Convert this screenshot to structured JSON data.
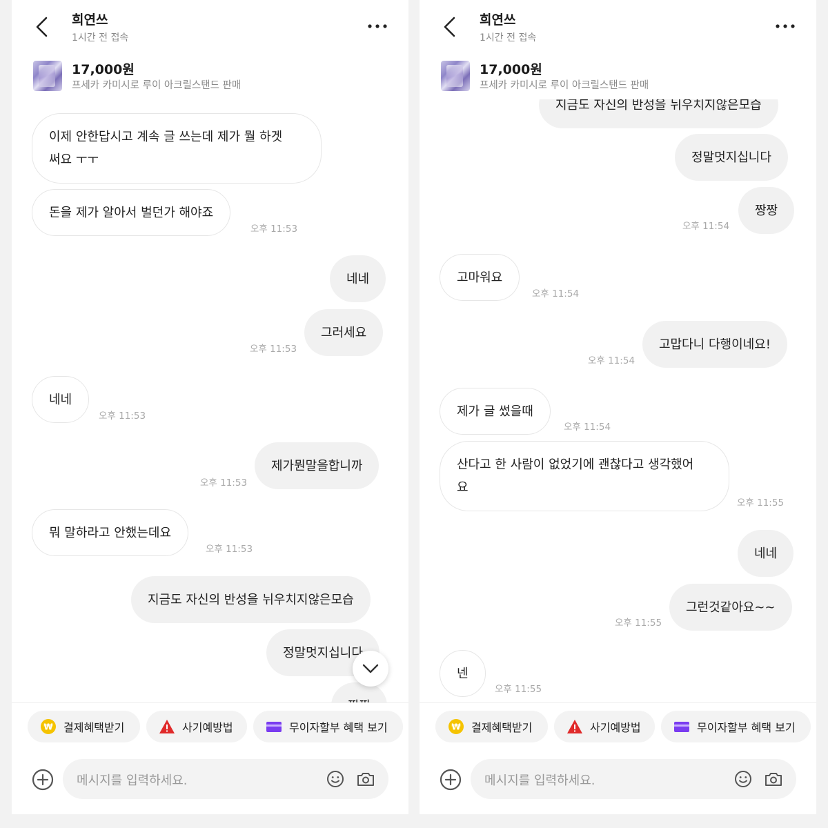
{
  "screens": [
    {
      "header": {
        "title": "희연쓰",
        "subtitle": "1시간 전 접속"
      },
      "product": {
        "price": "17,000원",
        "name": "프세카 카미시로 루이 아크릴스탠드 판매"
      },
      "messages": [
        {
          "text": "이제 안한답시고 계속 글 쓰는데 제가 뭘 하겟써요 ㅜㅜ"
        },
        {
          "text": "돈을 제가 알아서 벌던가 해야죠",
          "time": "오후 11:53"
        },
        {
          "text": "네네"
        },
        {
          "text": "그러세요",
          "time": "오후 11:53"
        },
        {
          "text": "네네",
          "time": "오후 11:53"
        },
        {
          "text": "제가뭔말을합니까",
          "time": "오후 11:53"
        },
        {
          "text": "뭐 말하라고 안했는데요",
          "time": "오후 11:53"
        },
        {
          "text": "지금도 자신의 반성을 뉘우치지않은모습"
        },
        {
          "text": "정말멋지십니다"
        },
        {
          "text": "짱짱"
        }
      ],
      "chips": [
        "결제혜택받기",
        "사기예방법",
        "무이자할부 혜택 보기"
      ],
      "input_placeholder": "메시지를 입력하세요."
    },
    {
      "header": {
        "title": "희연쓰",
        "subtitle": "1시간 전 접속"
      },
      "product": {
        "price": "17,000원",
        "name": "프세카 카미시로 루이 아크릴스탠드 판매"
      },
      "messages": [
        {
          "text": "지금도 자신의 반성을 뉘우치지않은모습"
        },
        {
          "text": "정말멋지십니다"
        },
        {
          "text": "짱짱",
          "time": "오후 11:54"
        },
        {
          "text": "고마워요",
          "time": "오후 11:54"
        },
        {
          "text": "고맙다니 다행이네요!",
          "time": "오후 11:54"
        },
        {
          "text": "제가 글 썼을때",
          "time": "오후 11:54"
        },
        {
          "text": "산다고 한 사람이 없었기에 괜찮다고 생각했어요",
          "time": "오후 11:55"
        },
        {
          "text": "네네"
        },
        {
          "text": "그런것같아요~~",
          "time": "오후 11:55"
        },
        {
          "text": "넨",
          "time": "오후 11:55"
        }
      ],
      "chips": [
        "결제혜택받기",
        "사기예방법",
        "무이자할부 혜택 보기"
      ],
      "input_placeholder": "메시지를 입력하세요."
    }
  ]
}
